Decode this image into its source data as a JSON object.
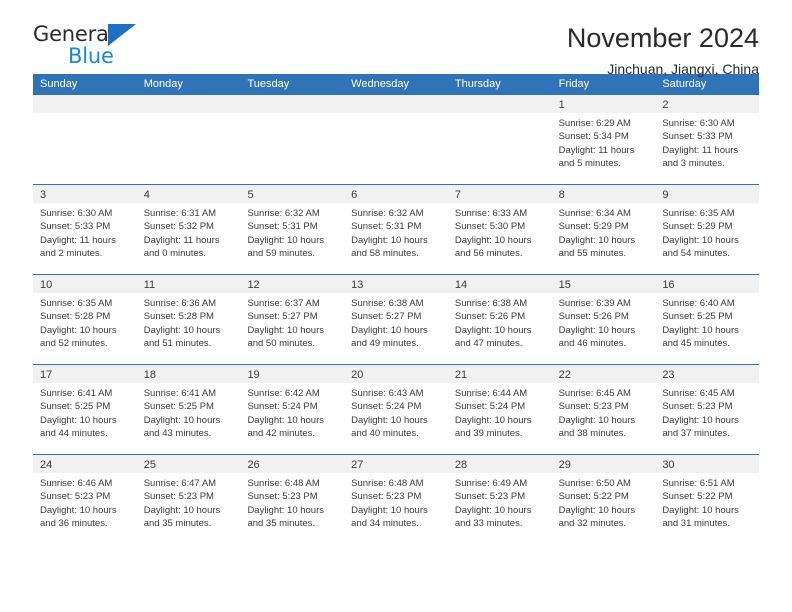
{
  "brand": {
    "name_top": "General",
    "name_bottom": "Blue",
    "accent_color": "#1f86d8",
    "header_color": "#3074b7"
  },
  "header": {
    "title": "November 2024",
    "subtitle": "Jinchuan, Jiangxi, China"
  },
  "calendar": {
    "weekday_headers": [
      "Sunday",
      "Monday",
      "Tuesday",
      "Wednesday",
      "Thursday",
      "Friday",
      "Saturday"
    ],
    "weeks": [
      [
        {
          "day": "",
          "empty": true,
          "lines": []
        },
        {
          "day": "",
          "empty": true,
          "lines": []
        },
        {
          "day": "",
          "empty": true,
          "lines": []
        },
        {
          "day": "",
          "empty": true,
          "lines": []
        },
        {
          "day": "",
          "empty": true,
          "lines": []
        },
        {
          "day": "1",
          "empty": false,
          "lines": [
            "Sunrise: 6:29 AM",
            "Sunset: 5:34 PM",
            "Daylight: 11 hours",
            "and 5 minutes."
          ]
        },
        {
          "day": "2",
          "empty": false,
          "lines": [
            "Sunrise: 6:30 AM",
            "Sunset: 5:33 PM",
            "Daylight: 11 hours",
            "and 3 minutes."
          ]
        }
      ],
      [
        {
          "day": "3",
          "empty": false,
          "lines": [
            "Sunrise: 6:30 AM",
            "Sunset: 5:33 PM",
            "Daylight: 11 hours",
            "and 2 minutes."
          ]
        },
        {
          "day": "4",
          "empty": false,
          "lines": [
            "Sunrise: 6:31 AM",
            "Sunset: 5:32 PM",
            "Daylight: 11 hours",
            "and 0 minutes."
          ]
        },
        {
          "day": "5",
          "empty": false,
          "lines": [
            "Sunrise: 6:32 AM",
            "Sunset: 5:31 PM",
            "Daylight: 10 hours",
            "and 59 minutes."
          ]
        },
        {
          "day": "6",
          "empty": false,
          "lines": [
            "Sunrise: 6:32 AM",
            "Sunset: 5:31 PM",
            "Daylight: 10 hours",
            "and 58 minutes."
          ]
        },
        {
          "day": "7",
          "empty": false,
          "lines": [
            "Sunrise: 6:33 AM",
            "Sunset: 5:30 PM",
            "Daylight: 10 hours",
            "and 56 minutes."
          ]
        },
        {
          "day": "8",
          "empty": false,
          "lines": [
            "Sunrise: 6:34 AM",
            "Sunset: 5:29 PM",
            "Daylight: 10 hours",
            "and 55 minutes."
          ]
        },
        {
          "day": "9",
          "empty": false,
          "lines": [
            "Sunrise: 6:35 AM",
            "Sunset: 5:29 PM",
            "Daylight: 10 hours",
            "and 54 minutes."
          ]
        }
      ],
      [
        {
          "day": "10",
          "empty": false,
          "lines": [
            "Sunrise: 6:35 AM",
            "Sunset: 5:28 PM",
            "Daylight: 10 hours",
            "and 52 minutes."
          ]
        },
        {
          "day": "11",
          "empty": false,
          "lines": [
            "Sunrise: 6:36 AM",
            "Sunset: 5:28 PM",
            "Daylight: 10 hours",
            "and 51 minutes."
          ]
        },
        {
          "day": "12",
          "empty": false,
          "lines": [
            "Sunrise: 6:37 AM",
            "Sunset: 5:27 PM",
            "Daylight: 10 hours",
            "and 50 minutes."
          ]
        },
        {
          "day": "13",
          "empty": false,
          "lines": [
            "Sunrise: 6:38 AM",
            "Sunset: 5:27 PM",
            "Daylight: 10 hours",
            "and 49 minutes."
          ]
        },
        {
          "day": "14",
          "empty": false,
          "lines": [
            "Sunrise: 6:38 AM",
            "Sunset: 5:26 PM",
            "Daylight: 10 hours",
            "and 47 minutes."
          ]
        },
        {
          "day": "15",
          "empty": false,
          "lines": [
            "Sunrise: 6:39 AM",
            "Sunset: 5:26 PM",
            "Daylight: 10 hours",
            "and 46 minutes."
          ]
        },
        {
          "day": "16",
          "empty": false,
          "lines": [
            "Sunrise: 6:40 AM",
            "Sunset: 5:25 PM",
            "Daylight: 10 hours",
            "and 45 minutes."
          ]
        }
      ],
      [
        {
          "day": "17",
          "empty": false,
          "lines": [
            "Sunrise: 6:41 AM",
            "Sunset: 5:25 PM",
            "Daylight: 10 hours",
            "and 44 minutes."
          ]
        },
        {
          "day": "18",
          "empty": false,
          "lines": [
            "Sunrise: 6:41 AM",
            "Sunset: 5:25 PM",
            "Daylight: 10 hours",
            "and 43 minutes."
          ]
        },
        {
          "day": "19",
          "empty": false,
          "lines": [
            "Sunrise: 6:42 AM",
            "Sunset: 5:24 PM",
            "Daylight: 10 hours",
            "and 42 minutes."
          ]
        },
        {
          "day": "20",
          "empty": false,
          "lines": [
            "Sunrise: 6:43 AM",
            "Sunset: 5:24 PM",
            "Daylight: 10 hours",
            "and 40 minutes."
          ]
        },
        {
          "day": "21",
          "empty": false,
          "lines": [
            "Sunrise: 6:44 AM",
            "Sunset: 5:24 PM",
            "Daylight: 10 hours",
            "and 39 minutes."
          ]
        },
        {
          "day": "22",
          "empty": false,
          "lines": [
            "Sunrise: 6:45 AM",
            "Sunset: 5:23 PM",
            "Daylight: 10 hours",
            "and 38 minutes."
          ]
        },
        {
          "day": "23",
          "empty": false,
          "lines": [
            "Sunrise: 6:45 AM",
            "Sunset: 5:23 PM",
            "Daylight: 10 hours",
            "and 37 minutes."
          ]
        }
      ],
      [
        {
          "day": "24",
          "empty": false,
          "lines": [
            "Sunrise: 6:46 AM",
            "Sunset: 5:23 PM",
            "Daylight: 10 hours",
            "and 36 minutes."
          ]
        },
        {
          "day": "25",
          "empty": false,
          "lines": [
            "Sunrise: 6:47 AM",
            "Sunset: 5:23 PM",
            "Daylight: 10 hours",
            "and 35 minutes."
          ]
        },
        {
          "day": "26",
          "empty": false,
          "lines": [
            "Sunrise: 6:48 AM",
            "Sunset: 5:23 PM",
            "Daylight: 10 hours",
            "and 35 minutes."
          ]
        },
        {
          "day": "27",
          "empty": false,
          "lines": [
            "Sunrise: 6:48 AM",
            "Sunset: 5:23 PM",
            "Daylight: 10 hours",
            "and 34 minutes."
          ]
        },
        {
          "day": "28",
          "empty": false,
          "lines": [
            "Sunrise: 6:49 AM",
            "Sunset: 5:23 PM",
            "Daylight: 10 hours",
            "and 33 minutes."
          ]
        },
        {
          "day": "29",
          "empty": false,
          "lines": [
            "Sunrise: 6:50 AM",
            "Sunset: 5:22 PM",
            "Daylight: 10 hours",
            "and 32 minutes."
          ]
        },
        {
          "day": "30",
          "empty": false,
          "lines": [
            "Sunrise: 6:51 AM",
            "Sunset: 5:22 PM",
            "Daylight: 10 hours",
            "and 31 minutes."
          ]
        }
      ]
    ]
  }
}
